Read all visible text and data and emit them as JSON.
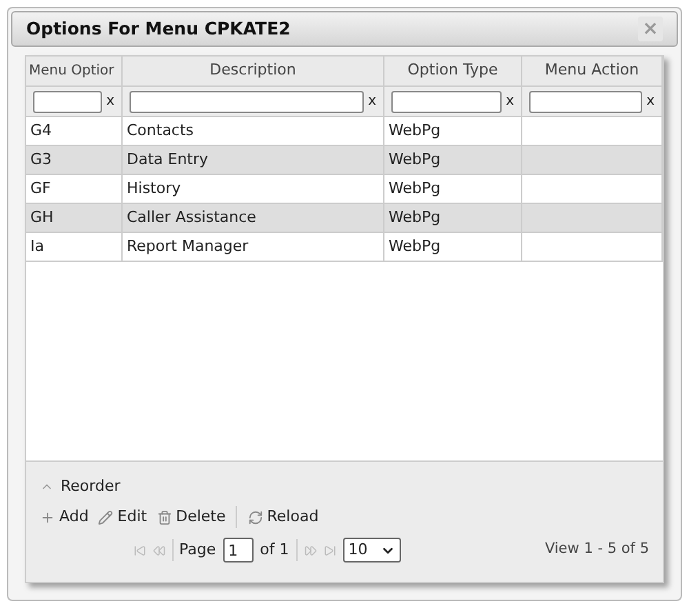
{
  "dialog": {
    "title": "Options For Menu CPKATE2",
    "close_label": "×"
  },
  "table": {
    "columns": [
      "Menu Optior",
      "Description",
      "Option Type",
      "Menu Action"
    ],
    "filter_clear": [
      "x",
      "x",
      "x",
      "x"
    ],
    "rows": [
      [
        "G4",
        "Contacts",
        "WebPg",
        ""
      ],
      [
        "G3",
        "Data Entry",
        "WebPg",
        ""
      ],
      [
        "GF",
        "History",
        "WebPg",
        ""
      ],
      [
        "GH",
        "Caller Assistance",
        "WebPg",
        ""
      ],
      [
        "Ia",
        "Report Manager",
        "WebPg",
        ""
      ]
    ]
  },
  "footer": {
    "reorder": "Reorder",
    "actions": [
      {
        "kind": "add",
        "label": "Add"
      },
      {
        "kind": "edit",
        "label": "Edit"
      },
      {
        "kind": "delete",
        "label": "Delete"
      },
      {
        "kind": "reload",
        "label": "Reload"
      }
    ],
    "pager": {
      "page_label": "Page",
      "page": "1",
      "of": "of 1",
      "page_size": "10",
      "view": "View 1 - 5 of 5"
    }
  }
}
